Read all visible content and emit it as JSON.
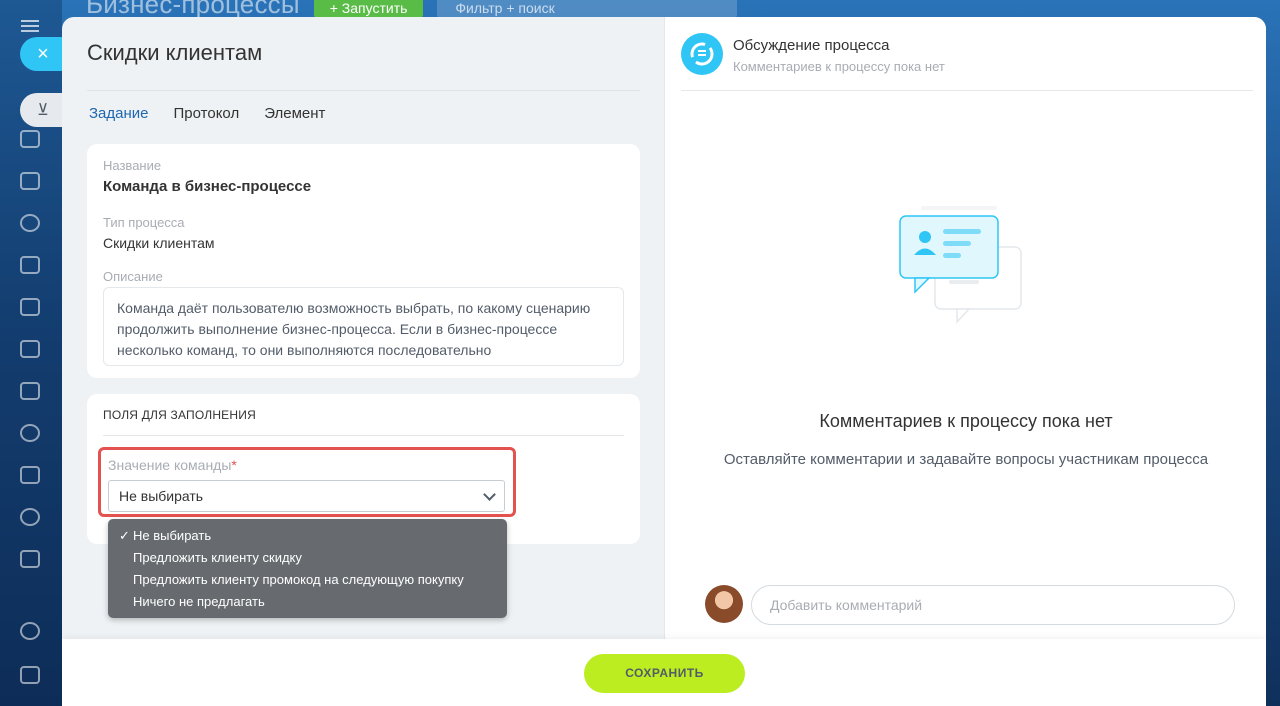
{
  "background": {
    "title": "Бизнес-процессы",
    "run_button": "+ Запустить",
    "filter_placeholder": "Фильтр + поиск"
  },
  "controls": {
    "close_icon": "×",
    "minimize_icon": "⊻"
  },
  "page": {
    "title": "Скидки клиентам",
    "tabs": [
      "Задание",
      "Протокол",
      "Элемент"
    ],
    "active_tab": "Задание"
  },
  "info": {
    "name_label": "Название",
    "name_value": "Команда в бизнес-процессе",
    "type_label": "Тип процесса",
    "type_value": "Скидки клиентам",
    "desc_label": "Описание",
    "desc_value": "Команда даёт пользователю возможность выбрать, по какому сценарию продолжить выполнение бизнес-процесса. Если в бизнес-процессе несколько команд, то они выполняются последовательно"
  },
  "fields": {
    "header": "поля для заполнения",
    "command_label": "Значение команды",
    "required_mark": "*",
    "selected": "Не выбирать",
    "options": [
      "Не выбирать",
      "Предложить клиенту скидку",
      "Предложить клиенту промокод на следующую покупку",
      "Ничего не предлагать"
    ],
    "check_mark": "✓"
  },
  "discussion": {
    "title": "Обсуждение процесса",
    "subtitle": "Комментариев к процессу пока нет",
    "empty_title": "Комментариев к процессу пока нет",
    "empty_text": "Оставляйте комментарии и задавайте вопросы участникам процесса",
    "comment_placeholder": "Добавить комментарий"
  },
  "footer": {
    "save_label": "СОХРАНИТЬ"
  },
  "colors": {
    "accent": "#2fc6f6",
    "save": "#bbed21",
    "highlight": "#e3524f",
    "active_tab": "#2067b0"
  }
}
